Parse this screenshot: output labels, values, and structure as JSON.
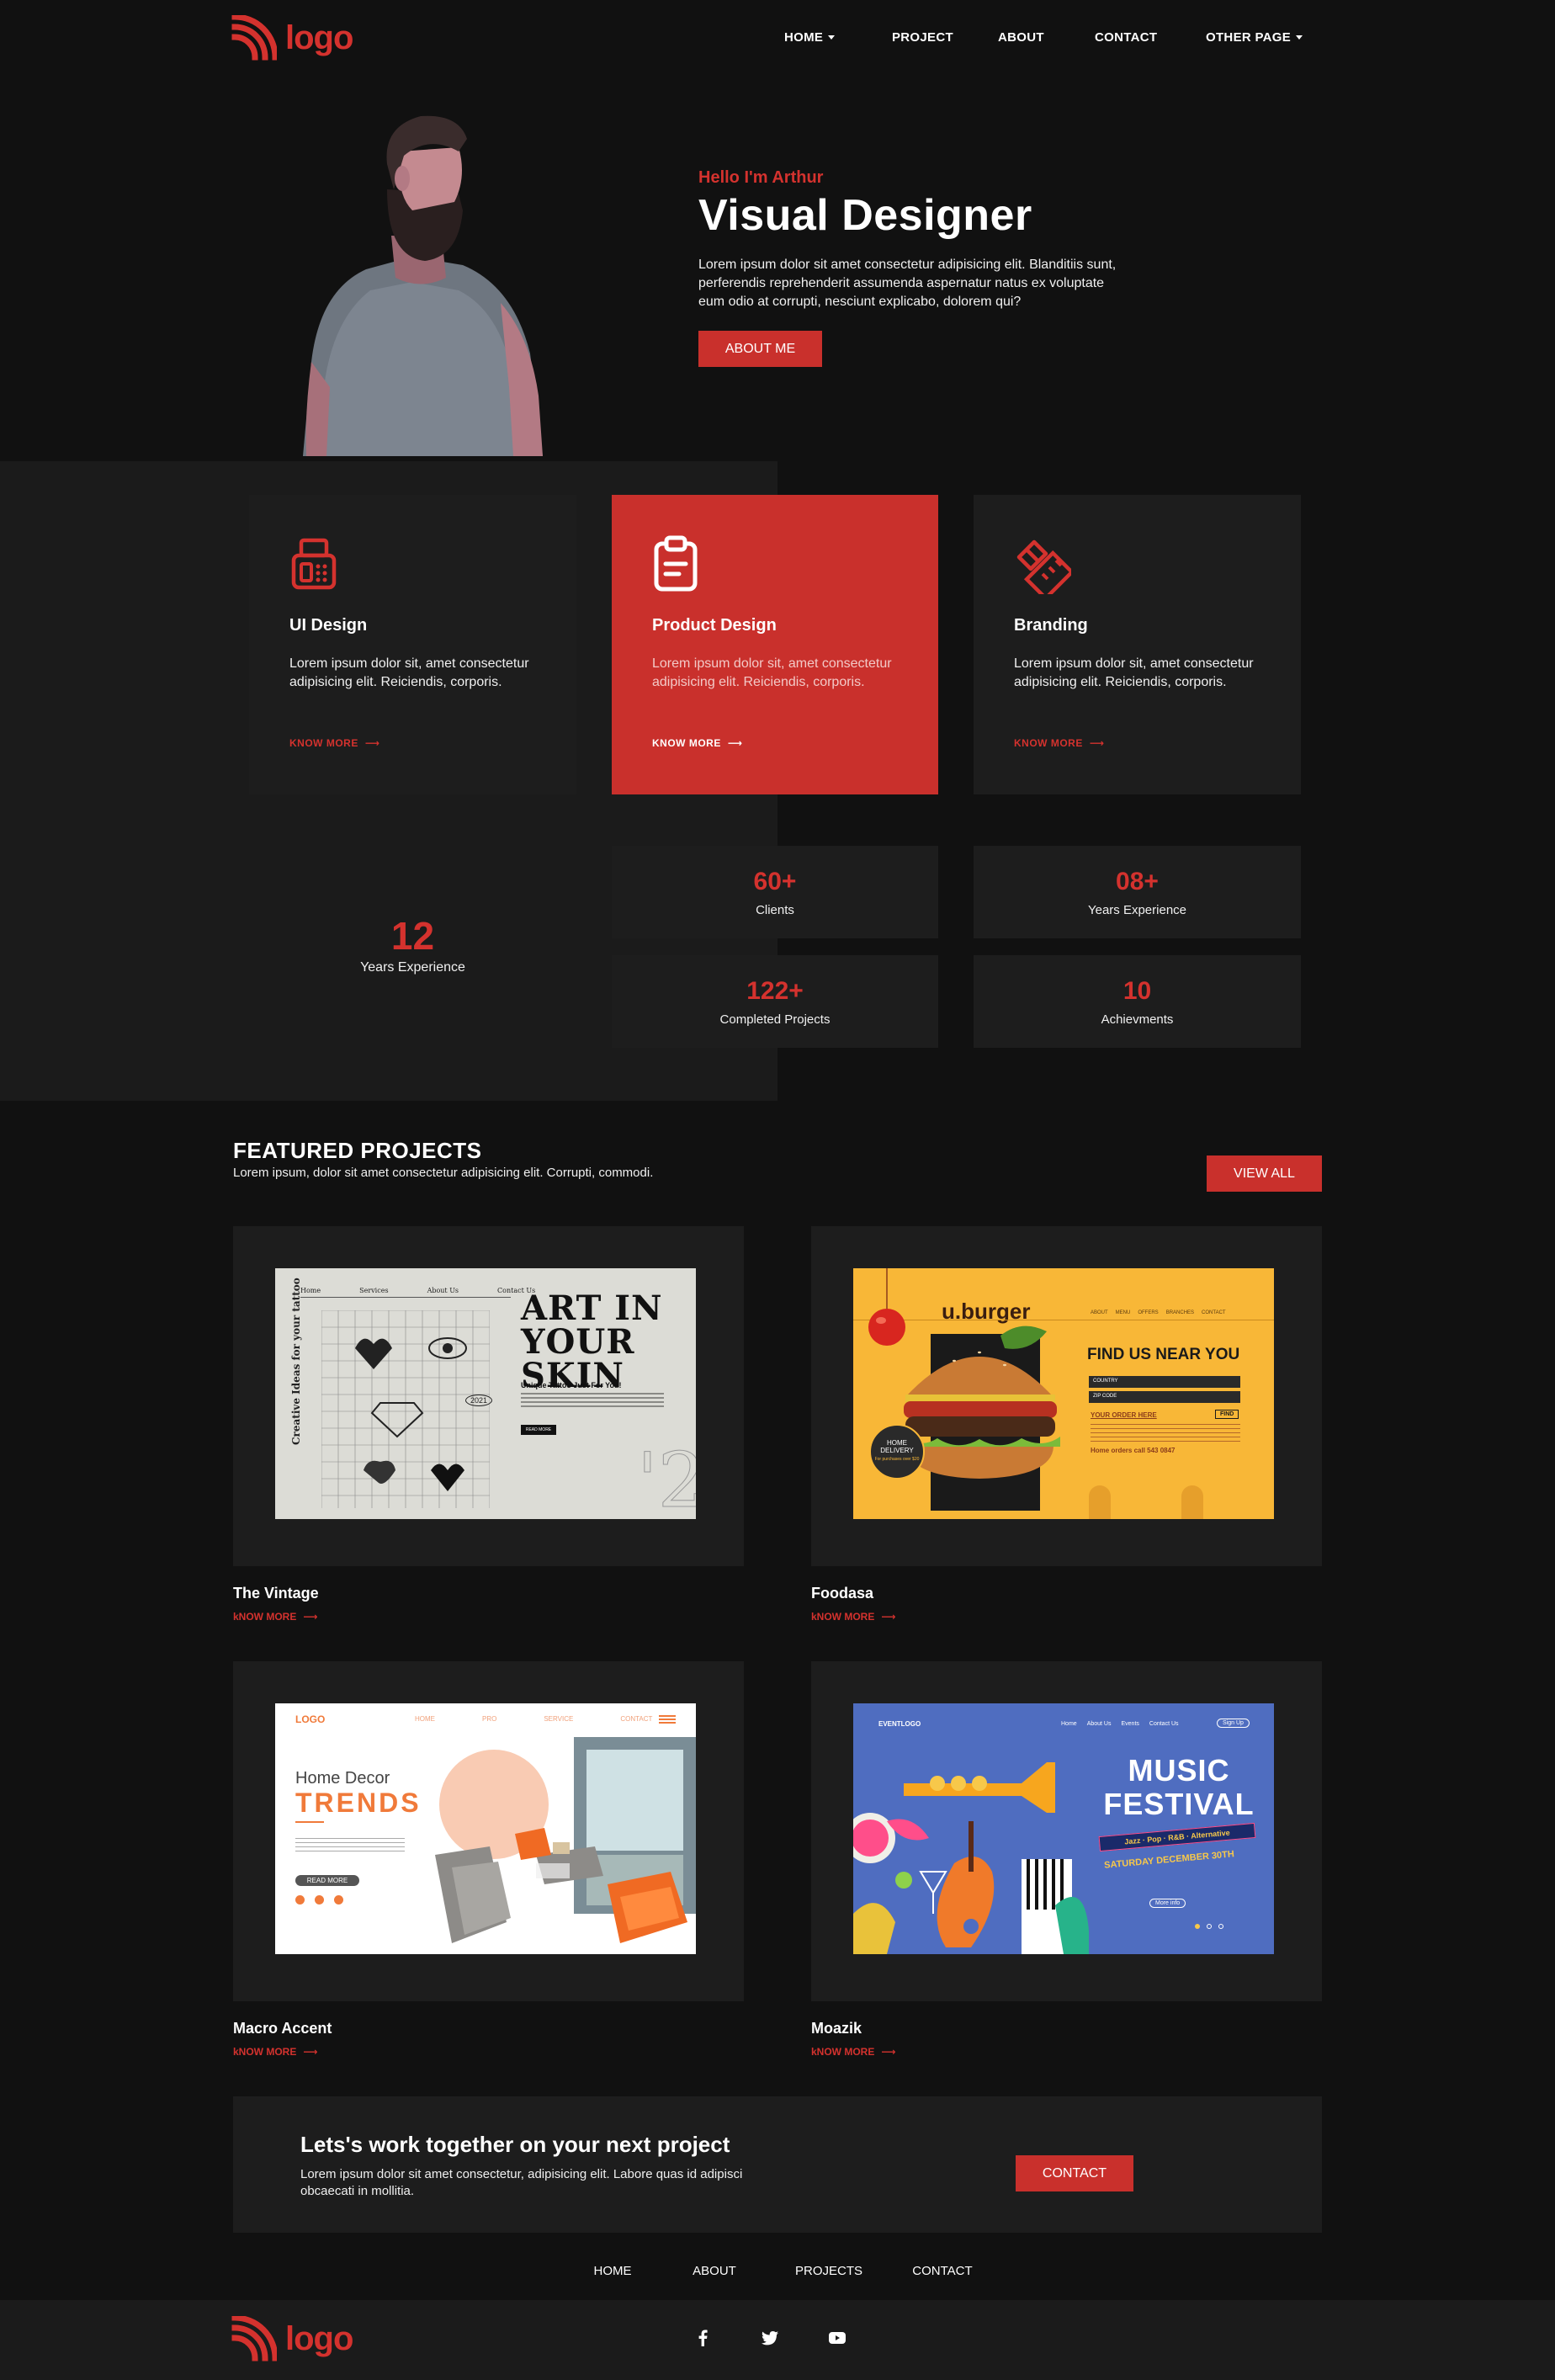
{
  "brand": {
    "logo_text": "logo",
    "accent": "#d4322e"
  },
  "nav": [
    {
      "label": "HOME",
      "dropdown": true
    },
    {
      "label": "PROJECT",
      "dropdown": false
    },
    {
      "label": "ABOUT",
      "dropdown": false
    },
    {
      "label": "CONTACT",
      "dropdown": false
    },
    {
      "label": "OTHER PAGE",
      "dropdown": true
    }
  ],
  "hero": {
    "eyebrow": "Hello I'm Arthur",
    "title": "Visual Designer",
    "description": "Lorem ipsum dolor sit amet consectetur adipisicing elit. Blanditiis sunt, perferendis reprehenderit assumenda aspernatur natus ex voluptate eum odio at corrupti, nesciunt explicabo, dolorem qui?",
    "button": "ABOUT ME"
  },
  "services": [
    {
      "icon": "fax-icon",
      "title": "UI Design",
      "description": "Lorem ipsum dolor sit, amet consectetur adipisicing elit. Reiciendis, corporis.",
      "link": "KNOW MORE",
      "active": false
    },
    {
      "icon": "clipboard-icon",
      "title": "Product Design",
      "description": "Lorem ipsum dolor sit, amet consectetur adipisicing elit. Reiciendis, corporis.",
      "link": "KNOW MORE",
      "active": true
    },
    {
      "icon": "ruler-pencil-icon",
      "title": "Branding",
      "description": "Lorem ipsum dolor sit, amet consectetur adipisicing elit. Reiciendis, corporis.",
      "link": "KNOW MORE",
      "active": false
    }
  ],
  "experience": {
    "value": "12",
    "label": "Years Experience"
  },
  "stats": [
    {
      "value": "60+",
      "label": "Clients"
    },
    {
      "value": "08+",
      "label": "Years Experience"
    },
    {
      "value": "122+",
      "label": "Completed Projects"
    },
    {
      "value": "10",
      "label": "Achievments"
    }
  ],
  "featured": {
    "title": "FEATURED PROJECTS",
    "subtitle": "Lorem ipsum, dolor sit amet consectetur adipisicing elit. Corrupti, commodi.",
    "button": "VIEW ALL",
    "projects": [
      {
        "title": "The Vintage",
        "link": "kNOW MORE"
      },
      {
        "title": "Foodasa",
        "link": "kNOW MORE"
      },
      {
        "title": "Macro Accent",
        "link": "kNOW MORE"
      },
      {
        "title": "Moazik",
        "link": "kNOW MORE"
      }
    ]
  },
  "mock_vintage": {
    "nav": [
      "Home",
      "Services",
      "About Us",
      "Contact Us"
    ],
    "headline1": "ART IN",
    "headline2": "YOUR SKIN",
    "side": "Creative Ideas for your tattoo",
    "tag": "Unique Tattoo Just For You!",
    "year": "2021",
    "cta": "READ MORE"
  },
  "mock_burger": {
    "brand": "u.burger",
    "nav": [
      "ABOUT",
      "MENU",
      "OFFERS",
      "BRANCHES",
      "CONTACT"
    ],
    "headline": "FIND US NEAR YOU",
    "field1": "COUNTRY",
    "field2": "ZIP CODE",
    "order": "YOUR ORDER HERE",
    "find": "FIND",
    "badge1": "HOME",
    "badge2": "DELIVERY",
    "badge3": "For purchases over $20",
    "phone": "Home orders call 543 0847"
  },
  "mock_decor": {
    "logo": "LOGO",
    "nav": [
      "HOME",
      "PRO",
      "SERVICE",
      "CONTACT"
    ],
    "line1": "Home  Decor",
    "line2": "TRENDS",
    "cta": "READ MORE"
  },
  "mock_music": {
    "logo": "EVENTLOGO",
    "nav": [
      "Home",
      "About Us",
      "Events",
      "Contact Us"
    ],
    "signup": "Sign Up",
    "title1": "MUSIC",
    "title2": "FESTIVAL",
    "genres": "Jazz · Pop · R&B · Alternative",
    "date": "SATURDAY DECEMBER 30TH",
    "more": "More info"
  },
  "cta": {
    "title": "Lets's work together on your next project",
    "description": "Lorem ipsum dolor sit amet consectetur, adipisicing elit. Labore quas id adipisci obcaecati in mollitia.",
    "button": "CONTACT"
  },
  "footer": {
    "nav": [
      "HOME",
      "ABOUT",
      "PROJECTS",
      "CONTACT"
    ],
    "logo_text": "logo",
    "social": [
      {
        "icon": "facebook-icon",
        "glyph": "f"
      },
      {
        "icon": "twitter-icon",
        "glyph": "t"
      },
      {
        "icon": "youtube-icon",
        "glyph": "▶"
      }
    ]
  }
}
